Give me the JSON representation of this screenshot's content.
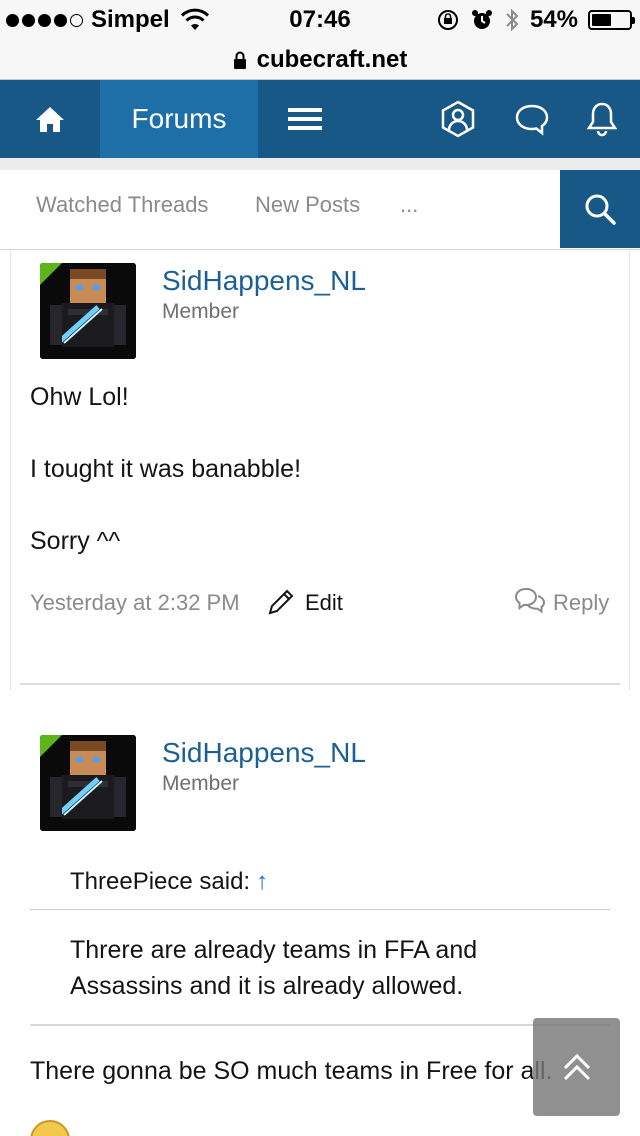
{
  "status_bar": {
    "carrier": "Simpel",
    "time": "07:46",
    "battery_percent_label": "54%",
    "battery_level": 0.54
  },
  "browser": {
    "url": "cubecraft.net"
  },
  "nav": {
    "active_tab": "Forums",
    "color_primary": "#185886",
    "color_active": "#1e6fa8"
  },
  "subnav": {
    "items": [
      "Watched Threads",
      "New Posts",
      "..."
    ]
  },
  "posts": [
    {
      "username": "SidHappens_NL",
      "role": "Member",
      "lines": [
        "Ohw Lol!",
        "I tought it was banabble!",
        "Sorry ^^"
      ],
      "timestamp": "Yesterday at 2:32 PM",
      "edit_label": "Edit",
      "reply_label": "Reply"
    },
    {
      "username": "SidHappens_NL",
      "role": "Member",
      "quote_author": "ThreePiece said:",
      "quote_arrow": "↑",
      "quote_text": "Threre are already teams in FFA and Assassins and it is already allowed.",
      "message": "There gonna be SO much teams in Free for all."
    }
  ]
}
